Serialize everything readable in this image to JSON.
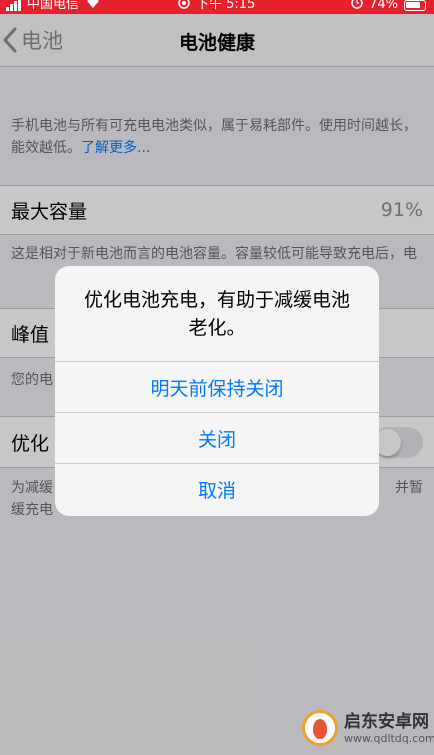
{
  "status_bar": {
    "carrier": "中国电信",
    "time": "下午 5:15",
    "battery": "74%"
  },
  "nav": {
    "back_label": "电池",
    "title": "电池健康"
  },
  "intro": {
    "text": "手机电池与所有可充电电池类似，属于易耗部件。使用时间越长，能效越低。",
    "link": "了解更多..."
  },
  "max_capacity": {
    "label": "最大容量",
    "value": "91%",
    "footnote": "这是相对于新电池而言的电池容量。容量较低可能导致充电后，电"
  },
  "peak": {
    "label": "峰值",
    "footnote": "您的电"
  },
  "optimized": {
    "label": "优化",
    "footnote_left": "为减缓",
    "footnote_right": "并暂",
    "footnote_line2": "缓充电"
  },
  "alert": {
    "message": "优化电池充电，有助于减缓电池老化。",
    "buttons": [
      "明天前保持关闭",
      "关闭",
      "取消"
    ]
  },
  "watermark": {
    "name": "启东安卓网",
    "url": "www.qdltdq.com"
  },
  "colors": {
    "status_bar": "#e5212d",
    "accent": "#007aff"
  }
}
